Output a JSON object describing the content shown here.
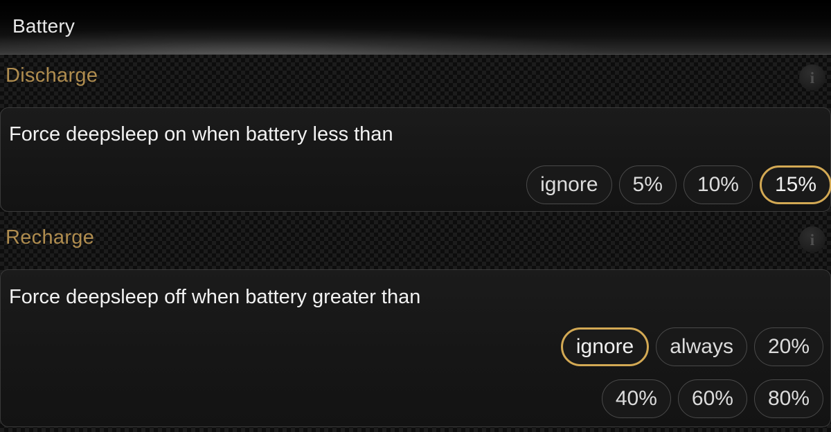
{
  "titlebar": {
    "title": "Battery"
  },
  "sections": [
    {
      "header": "Discharge",
      "info_icon_glyph": "i",
      "panel_title": "Force deepsleep on when battery less than",
      "rows": [
        [
          {
            "label": "ignore",
            "selected": false
          },
          {
            "label": "5%",
            "selected": false
          },
          {
            "label": "10%",
            "selected": false
          },
          {
            "label": "15%",
            "selected": true
          }
        ]
      ]
    },
    {
      "header": "Recharge",
      "info_icon_glyph": "i",
      "panel_title": "Force deepsleep off when battery greater than",
      "rows": [
        [
          {
            "label": "ignore",
            "selected": true
          },
          {
            "label": "always",
            "selected": false
          },
          {
            "label": "20%",
            "selected": false
          }
        ],
        [
          {
            "label": "40%",
            "selected": false
          },
          {
            "label": "60%",
            "selected": false
          },
          {
            "label": "80%",
            "selected": false
          }
        ]
      ]
    }
  ],
  "colors": {
    "accent_gold": "#d3a954",
    "header_gold": "#b08d4f",
    "text_primary": "#f2f2f2",
    "chip_border": "#4a4a4a",
    "background": "#0d0d0d"
  }
}
